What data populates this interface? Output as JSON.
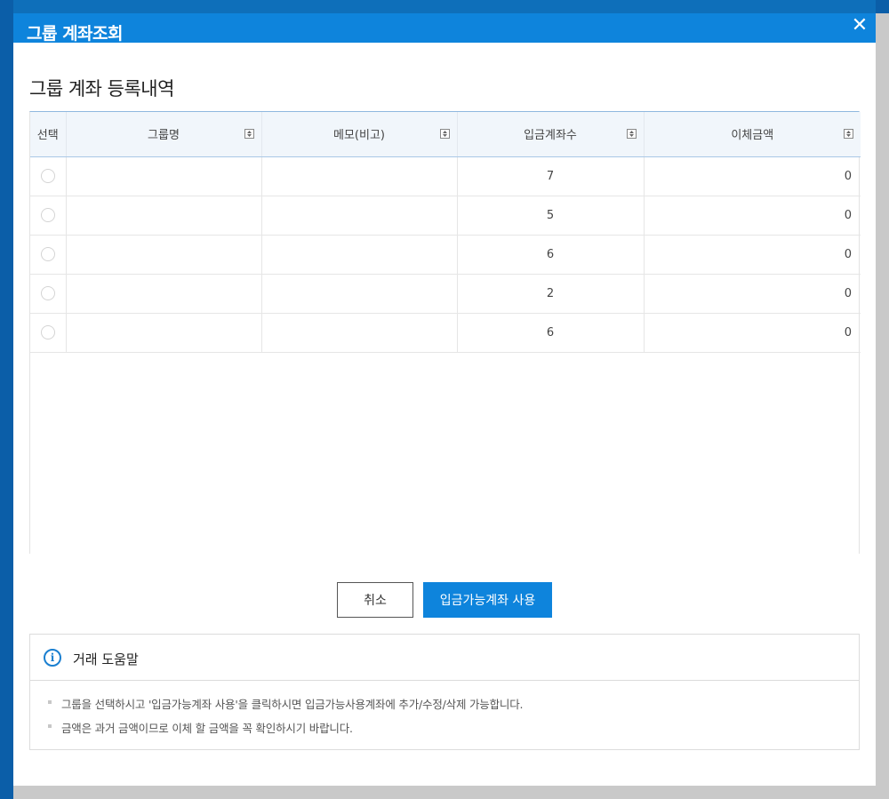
{
  "modal": {
    "title": "그룹 계좌조회",
    "close_icon": "close-icon"
  },
  "section": {
    "title": "그룹 계좌 등록내역"
  },
  "table": {
    "columns": [
      "선택",
      "그룹명",
      "메모(비고)",
      "입금계좌수",
      "이체금액"
    ],
    "rows": [
      {
        "group": "",
        "memo": "",
        "count": "7",
        "amount": "0"
      },
      {
        "group": "",
        "memo": "",
        "count": "5",
        "amount": "0"
      },
      {
        "group": "",
        "memo": "",
        "count": "6",
        "amount": "0"
      },
      {
        "group": "",
        "memo": "",
        "count": "2",
        "amount": "0"
      },
      {
        "group": "",
        "memo": "",
        "count": "6",
        "amount": "0"
      }
    ]
  },
  "buttons": {
    "cancel": "취소",
    "use": "입금가능계좌 사용"
  },
  "help": {
    "title": "거래 도움말",
    "items": [
      "그룹을 선택하시고 '입금가능계좌 사용'을 클릭하시면 입금가능사용계좌에 추가/수정/삭제 가능합니다.",
      "금액은 과거 금액이므로 이체 할 금액을 꼭 확인하시기 바랍니다."
    ]
  },
  "colors": {
    "header": "#0e84dc",
    "primary_button": "#0e84dc",
    "info_icon": "#1a7fd0"
  }
}
